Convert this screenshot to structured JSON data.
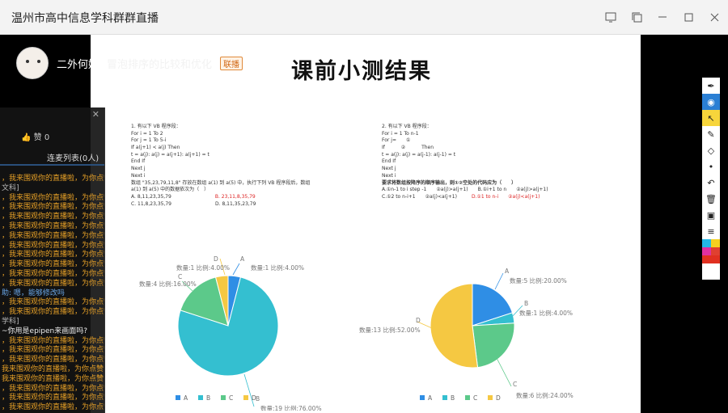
{
  "window": {
    "title": "温州市高中信息学科群群直播"
  },
  "streamer": {
    "name": "二外何媛",
    "topic": "冒泡排序的比较和优化",
    "tag": "联播"
  },
  "slide": {
    "title": "课前小测结果",
    "q1": {
      "lines": [
        "1. 有以下 VB 程序段：",
        "For i = 1 To 2",
        "  For j = 1 To 5-i",
        "    If a(j+1) < a(j) Then",
        "      t = a(j): a(j) = a(j+1): a(j+1) = t",
        "    End If",
        "  Next j",
        "Next i",
        "数组 \"35,23,79,11,8\" 存放在数组 a(1) 到 a(5) 中，执行下列 VB 程序段后，数组",
        "a(1) 到 a(5) 中的数据依次为（　）"
      ],
      "options": [
        "A. 8,11,23,35,79",
        "B. 23,11,8,35,79",
        "C. 11,8,23,35,79",
        "D. 8,11,35,23,79"
      ]
    },
    "q2": {
      "lines": [
        "2. 有以下 VB 程序段：",
        "For i = 1 To n-1",
        "  For j=　　①",
        "    If 　　　②　　　 Then",
        "      t = a(j): a(j) = a(j-1): a(j-1) = t",
        "    End If",
        "  Next j",
        "Next i",
        "要求将数组按降序的顺序输出，则①②空处的代码应为（　　）"
      ],
      "options": [
        "A.①n-1 to i step -1　　②a(j)>a(j+1)",
        "B.①i+1 to n　　②a(j)>a(j+1)",
        "C.①2 to n-i+1　　②a(j)<a(j+1)",
        "D.①1 to n-i　　②a(j)<a(j+1)"
      ]
    }
  },
  "chat": {
    "like_count": "赞 0",
    "tab_list": "连麦列表(0人)",
    "messages": [
      {
        "text": "，我来围观你的直播啦，为你点赞!",
        "style": "orange"
      },
      {
        "text": "文科]",
        "style": "gray"
      },
      {
        "text": "，我来围观你的直播啦，为你点赞!",
        "style": "orange"
      },
      {
        "text": "，我来围观你的直播啦，为你点赞!",
        "style": "orange"
      },
      {
        "text": "，我来围观你的直播啦，为你点赞!",
        "style": "orange"
      },
      {
        "text": "，我来围观你的直播啦，为你点赞!",
        "style": "orange"
      },
      {
        "text": "，我来围观你的直播啦，为你点赞!",
        "style": "orange"
      },
      {
        "text": "，我来围观你的直播啦，为你点赞!",
        "style": "orange"
      },
      {
        "text": "，我来围观你的直播啦，为你点赞!",
        "style": "orange"
      },
      {
        "text": "，我来围观你的直播啦，为你点赞!",
        "style": "orange"
      },
      {
        "text": "，我来围观你的直播啦，为你点赞!",
        "style": "orange"
      },
      {
        "text": "，我来围观你的直播啦，为你点赞!",
        "style": "orange"
      },
      {
        "text": "助: 嗯，能够修改吗",
        "style": "blue"
      },
      {
        "text": "，我来围观你的直播啦，为你点赞!",
        "style": "orange"
      },
      {
        "text": "，我来围观你的直播啦，为你点赞!",
        "style": "orange"
      },
      {
        "text": "学科]",
        "style": "gray"
      },
      {
        "text": "~你用是epipen来画面吗?",
        "style": "white"
      },
      {
        "text": "，我来围观你的直播啦，为你点赞!",
        "style": "orange"
      },
      {
        "text": "，我来围观你的直播啦，为你点赞!",
        "style": "orange"
      },
      {
        "text": "，我来围观你的直播啦，为你点赞!",
        "style": "orange"
      },
      {
        "text": "我来围观你的直播啦，为你点赞!",
        "style": "orange"
      },
      {
        "text": "我来围观你的直播啦，为你点赞!",
        "style": "orange"
      },
      {
        "text": "，我来围观你的直播啦，为你点赞!",
        "style": "orange"
      },
      {
        "text": "，我来围观你的直播啦，为你点赞!",
        "style": "orange"
      },
      {
        "text": "，我来围观你的直播啦，为你点赞!",
        "style": "orange"
      }
    ]
  },
  "chart_data": [
    {
      "type": "pie",
      "categories": [
        "A",
        "B",
        "C",
        "D"
      ],
      "values": [
        1,
        19,
        4,
        1
      ],
      "percents": [
        "4.00%",
        "76.00%",
        "16.00%",
        "4.00%"
      ],
      "labels": [
        "数量:1 比例:4.00%",
        "数量:19 比例:76.00%",
        "数量:4 比例:16.00%",
        "数量:1 比例:4.00%"
      ],
      "colors": [
        "#2f8ee5",
        "#34bfd0",
        "#5cc98a",
        "#f5c842"
      ],
      "legend": "bottom"
    },
    {
      "type": "pie",
      "categories": [
        "A",
        "B",
        "C",
        "D"
      ],
      "values": [
        5,
        1,
        6,
        13
      ],
      "percents": [
        "20.00%",
        "4.00%",
        "24.00%",
        "52.00%"
      ],
      "labels": [
        "数量:5 比例:20.00%",
        "数量:1 比例:4.00%",
        "数量:6 比例:24.00%",
        "数量:13 比例:52.00%"
      ],
      "colors": [
        "#2f8ee5",
        "#34bfd0",
        "#5cc98a",
        "#f5c842"
      ],
      "legend": "bottom"
    }
  ]
}
